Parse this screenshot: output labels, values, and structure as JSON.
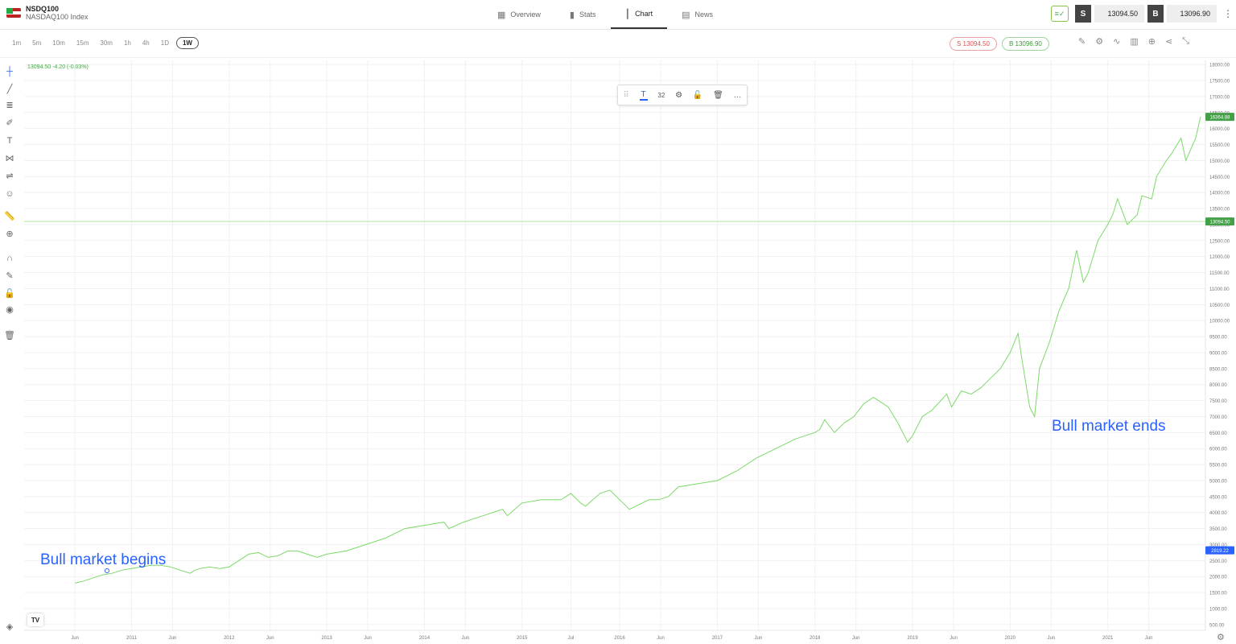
{
  "instrument": {
    "symbol": "NSDQ100",
    "name": "NASDAQ100 Index"
  },
  "nav": {
    "tabs": [
      {
        "label": "Overview",
        "icon": "grid-icon"
      },
      {
        "label": "Stats",
        "icon": "bar-stats-icon"
      },
      {
        "label": "Chart",
        "icon": "candlestick-icon"
      },
      {
        "label": "News",
        "icon": "newspaper-icon"
      }
    ],
    "active": "Chart"
  },
  "trade": {
    "sell_label": "S",
    "sell_price": "13094.50",
    "buy_label": "B",
    "buy_price": "13096.90",
    "sell_color": "#444444",
    "buy_color": "#444444"
  },
  "timeframes": {
    "items": [
      "1m",
      "5m",
      "10m",
      "15m",
      "30m",
      "1h",
      "4h",
      "1D",
      "1W"
    ],
    "selected": "1W"
  },
  "quote_pills": {
    "sell": "S 13094.50",
    "buy": "B 13096.90"
  },
  "legend": {
    "text": "13094.50  -4.20 (-0.03%)",
    "color": "#43a047"
  },
  "floating_toolbar": {
    "font_size": "32"
  },
  "annotations": {
    "start": "Bull market begins",
    "end": "Bull market ends",
    "color": "#2962ff"
  },
  "price_badges": {
    "high": {
      "value": "16364.88",
      "color": "#43a047"
    },
    "last": {
      "value": "13094.50",
      "color": "#43a047"
    },
    "start": {
      "value": "2819.22",
      "color": "#2962ff"
    }
  },
  "logo_text": "TV",
  "chart_data": {
    "type": "line",
    "title": "",
    "xlabel": "",
    "ylabel": "",
    "ylim": [
      320,
      18130
    ],
    "y_ticks": [
      500,
      1000,
      1500,
      2000,
      2500,
      3000,
      3500,
      4000,
      4500,
      5000,
      5500,
      6000,
      6500,
      7000,
      7500,
      8000,
      8500,
      9000,
      9500,
      10000,
      10500,
      11000,
      11500,
      12000,
      12500,
      13000,
      13500,
      14000,
      14500,
      15000,
      15500,
      16000,
      16500,
      17000,
      17500,
      18000
    ],
    "x_range": [
      2009.9,
      2022.0
    ],
    "x_ticks": [
      {
        "x": 2010.42,
        "label": "Jun"
      },
      {
        "x": 2011.0,
        "label": "2011"
      },
      {
        "x": 2011.42,
        "label": "Jun"
      },
      {
        "x": 2012.0,
        "label": "2012"
      },
      {
        "x": 2012.42,
        "label": "Jun"
      },
      {
        "x": 2013.0,
        "label": "2013"
      },
      {
        "x": 2013.42,
        "label": "Jun"
      },
      {
        "x": 2014.0,
        "label": "2014"
      },
      {
        "x": 2014.42,
        "label": "Jun"
      },
      {
        "x": 2015.0,
        "label": "2015"
      },
      {
        "x": 2015.5,
        "label": "Jul"
      },
      {
        "x": 2016.0,
        "label": "2016"
      },
      {
        "x": 2016.42,
        "label": "Jun"
      },
      {
        "x": 2017.0,
        "label": "2017"
      },
      {
        "x": 2017.42,
        "label": "Jun"
      },
      {
        "x": 2018.0,
        "label": "2018"
      },
      {
        "x": 2018.42,
        "label": "Jun"
      },
      {
        "x": 2019.0,
        "label": "2019"
      },
      {
        "x": 2019.42,
        "label": "Jun"
      },
      {
        "x": 2020.0,
        "label": "2020"
      },
      {
        "x": 2020.42,
        "label": "Jun"
      },
      {
        "x": 2021.0,
        "label": "2021"
      },
      {
        "x": 2021.42,
        "label": "Jun"
      }
    ],
    "line_color": "#7cd96a",
    "grid": true,
    "series": [
      {
        "x": [
          2010.42,
          2010.5,
          2010.6,
          2010.7,
          2010.8,
          2010.9,
          2011.0,
          2011.1,
          2011.2,
          2011.3,
          2011.4,
          2011.5,
          2011.6,
          2011.65,
          2011.7,
          2011.8,
          2011.9,
          2012.0,
          2012.1,
          2012.2,
          2012.3,
          2012.4,
          2012.5,
          2012.6,
          2012.7,
          2012.8,
          2012.9,
          2013.0,
          2013.2,
          2013.4,
          2013.6,
          2013.8,
          2014.0,
          2014.2,
          2014.25,
          2014.4,
          2014.6,
          2014.8,
          2014.85,
          2015.0,
          2015.2,
          2015.4,
          2015.5,
          2015.6,
          2015.65,
          2015.8,
          2015.9,
          2016.0,
          2016.1,
          2016.3,
          2016.4,
          2016.5,
          2016.6,
          2016.8,
          2017.0,
          2017.2,
          2017.4,
          2017.6,
          2017.8,
          2018.0,
          2018.05,
          2018.1,
          2018.2,
          2018.3,
          2018.4,
          2018.5,
          2018.6,
          2018.75,
          2018.85,
          2018.95,
          2019.0,
          2019.1,
          2019.2,
          2019.35,
          2019.4,
          2019.5,
          2019.6,
          2019.7,
          2019.8,
          2019.9,
          2020.0,
          2020.08,
          2020.12,
          2020.2,
          2020.25,
          2020.3,
          2020.4,
          2020.5,
          2020.6,
          2020.68,
          2020.75,
          2020.8,
          2020.9,
          2021.0,
          2021.05,
          2021.1,
          2021.2,
          2021.3,
          2021.35,
          2021.45,
          2021.5,
          2021.6,
          2021.65,
          2021.75,
          2021.8,
          2021.9,
          2021.95
        ],
        "y": [
          1800,
          1850,
          1950,
          2050,
          2100,
          2200,
          2250,
          2300,
          2350,
          2350,
          2300,
          2200,
          2100,
          2200,
          2250,
          2300,
          2250,
          2300,
          2500,
          2700,
          2750,
          2600,
          2650,
          2800,
          2800,
          2700,
          2600,
          2700,
          2800,
          3000,
          3200,
          3500,
          3600,
          3700,
          3500,
          3700,
          3900,
          4100,
          3900,
          4300,
          4400,
          4400,
          4600,
          4300,
          4200,
          4600,
          4700,
          4400,
          4100,
          4400,
          4400,
          4500,
          4800,
          4900,
          5000,
          5300,
          5700,
          6000,
          6300,
          6500,
          6600,
          6900,
          6500,
          6800,
          7000,
          7400,
          7600,
          7300,
          6800,
          6200,
          6400,
          7000,
          7200,
          7700,
          7300,
          7800,
          7700,
          7900,
          8200,
          8500,
          9000,
          9600,
          8800,
          7300,
          7000,
          8500,
          9300,
          10300,
          11000,
          12200,
          11200,
          11500,
          12500,
          13000,
          13300,
          13800,
          13000,
          13300,
          13900,
          13800,
          14500,
          15000,
          15200,
          15700,
          15000,
          15700,
          16364.88
        ]
      }
    ]
  }
}
